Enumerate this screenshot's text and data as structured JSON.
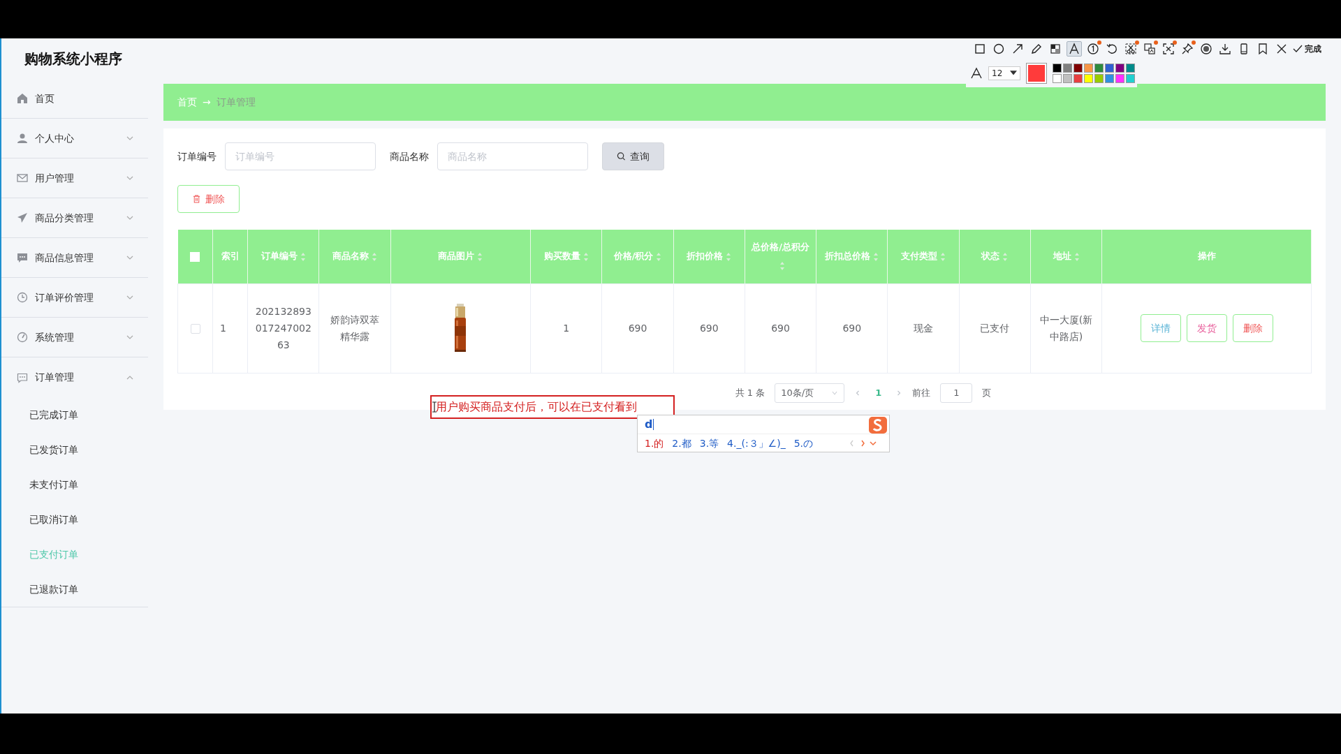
{
  "app": {
    "title": "购物系统小程序"
  },
  "sidebar": {
    "items": [
      {
        "label": "首页",
        "kind": "link"
      },
      {
        "label": "个人中心",
        "kind": "menu",
        "expanded": false
      },
      {
        "label": "用户管理",
        "kind": "menu",
        "expanded": false
      },
      {
        "label": "商品分类管理",
        "kind": "menu",
        "expanded": false
      },
      {
        "label": "商品信息管理",
        "kind": "menu",
        "expanded": false
      },
      {
        "label": "订单评价管理",
        "kind": "menu",
        "expanded": false
      },
      {
        "label": "系统管理",
        "kind": "menu",
        "expanded": false
      },
      {
        "label": "订单管理",
        "kind": "menu",
        "expanded": true,
        "children": [
          {
            "label": "已完成订单",
            "selected": false
          },
          {
            "label": "已发货订单",
            "selected": false
          },
          {
            "label": "未支付订单",
            "selected": false
          },
          {
            "label": "已取消订单",
            "selected": false
          },
          {
            "label": "已支付订单",
            "selected": true
          },
          {
            "label": "已退款订单",
            "selected": false
          }
        ]
      }
    ]
  },
  "breadcrumb": {
    "items": [
      "首页",
      "订单管理"
    ],
    "separator": "→"
  },
  "search": {
    "fields": [
      {
        "label": "订单编号",
        "placeholder": "订单编号"
      },
      {
        "label": "商品名称",
        "placeholder": "商品名称"
      }
    ],
    "button": "查询"
  },
  "delete_button": "删除",
  "table": {
    "select_all_checked": false,
    "columns": [
      {
        "label": "索引",
        "sortable": false
      },
      {
        "label": "订单编号",
        "sortable": true
      },
      {
        "label": "商品名称",
        "sortable": true
      },
      {
        "label": "商品图片",
        "sortable": true
      },
      {
        "label": "购买数量",
        "sortable": true
      },
      {
        "label": "价格/积分",
        "sortable": true
      },
      {
        "label": "折扣价格",
        "sortable": true
      },
      {
        "label": "总价格/总积分",
        "sortable": true
      },
      {
        "label": "折扣总价格",
        "sortable": true
      },
      {
        "label": "支付类型",
        "sortable": true
      },
      {
        "label": "状态",
        "sortable": true
      },
      {
        "label": "地址",
        "sortable": true
      },
      {
        "label": "操作",
        "sortable": false
      }
    ],
    "rows": [
      {
        "checked": false,
        "cells": [
          {
            "kind": "text",
            "text": "1"
          },
          {
            "kind": "text",
            "text": "20213289301724700263"
          },
          {
            "kind": "text",
            "text": "娇韵诗双萃精华露"
          },
          {
            "kind": "picture"
          },
          {
            "kind": "text",
            "text": "1"
          },
          {
            "kind": "text",
            "text": "690"
          },
          {
            "kind": "text",
            "text": "690"
          },
          {
            "kind": "text",
            "text": "690"
          },
          {
            "kind": "text",
            "text": "690"
          },
          {
            "kind": "text",
            "text": "现金"
          },
          {
            "kind": "text",
            "text": "已支付"
          },
          {
            "kind": "text",
            "text": "中一大厦(新中路店)"
          },
          {
            "kind": "actions",
            "actions": [
              {
                "label": "详情",
                "color": "#5ab4d6"
              },
              {
                "label": "发货",
                "color": "#e85c9a"
              },
              {
                "label": "删除",
                "color": "#f05a5a"
              }
            ]
          }
        ]
      }
    ]
  },
  "pagination": {
    "total": "共 1 条",
    "page_size": "10条/页",
    "pages": [
      {
        "label": "1",
        "selected": true
      }
    ],
    "goto": "前往",
    "goto_value": "1",
    "goto_suffix": "页"
  },
  "annotation": {
    "text": "用户购买商品支付后，可以在已支付看到"
  },
  "ime": {
    "input": "d",
    "candidates": [
      {
        "label": "1.的",
        "selected": true
      },
      {
        "label": "2.都",
        "selected": false
      },
      {
        "label": "3.等",
        "selected": false
      },
      {
        "label": "4._(:３」∠)_",
        "selected": false
      },
      {
        "label": "5.の",
        "selected": false
      }
    ]
  },
  "toolbar": {
    "tools": [
      {
        "kind": "rect",
        "selected": false,
        "dot": false
      },
      {
        "kind": "ellipse",
        "selected": false,
        "dot": false
      },
      {
        "kind": "arrow",
        "selected": false,
        "dot": false
      },
      {
        "kind": "pencil",
        "selected": false,
        "dot": false
      },
      {
        "kind": "mosaic",
        "selected": false,
        "dot": false
      },
      {
        "kind": "text",
        "selected": true,
        "dot": false
      },
      {
        "kind": "number",
        "selected": false,
        "dot": true
      },
      {
        "kind": "undo",
        "selected": false,
        "dot": false
      },
      {
        "kind": "cut",
        "selected": false,
        "dot": true
      },
      {
        "kind": "translate",
        "selected": false,
        "dot": true
      },
      {
        "kind": "ocr",
        "selected": false,
        "dot": true
      },
      {
        "kind": "pin",
        "selected": false,
        "dot": true
      },
      {
        "kind": "record",
        "selected": false,
        "dot": false
      },
      {
        "kind": "download",
        "selected": false,
        "dot": false
      },
      {
        "kind": "phone",
        "selected": false,
        "dot": false
      },
      {
        "kind": "bookmark",
        "selected": false,
        "dot": false
      },
      {
        "kind": "close",
        "selected": false,
        "dot": false
      }
    ],
    "done": "完成",
    "font_size": "12",
    "current_color": {
      "color": "#ff3b3b"
    },
    "palette": [
      {
        "color": "#000000"
      },
      {
        "color": "#808080"
      },
      {
        "color": "#800000"
      },
      {
        "color": "#f79646"
      },
      {
        "color": "#2e8b3e"
      },
      {
        "color": "#3060d0"
      },
      {
        "color": "#800080"
      },
      {
        "color": "#008b8b"
      },
      {
        "color": "#ffffff"
      },
      {
        "color": "#c0c0c0"
      },
      {
        "color": "#e84040"
      },
      {
        "color": "#ffff00"
      },
      {
        "color": "#99cc00"
      },
      {
        "color": "#3090e0"
      },
      {
        "color": "#ff30ff"
      },
      {
        "color": "#20d0d0"
      }
    ]
  }
}
